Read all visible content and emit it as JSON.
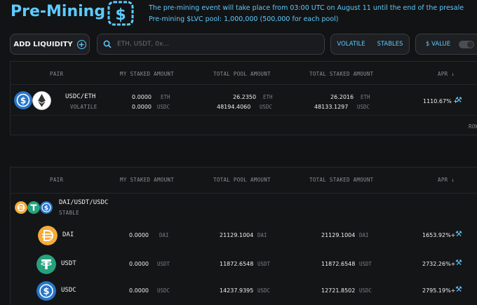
{
  "header": {
    "title": "Pre-Mining",
    "notice_line1": "The pre-mining event will take place from 03:00 UTC on August 11 until the end of the presale",
    "notice_line2": "Pre-mining $LVC pool: 1,000,000 (500,000 for each pool)"
  },
  "toolbar": {
    "add_liquidity": "ADD LIQUIDITY",
    "search_placeholder": "ETH, USDT, 0x...",
    "filter_volatile": "VOLATILE",
    "filter_stables": "STABLES",
    "value_label": "$ VALUE"
  },
  "columns": {
    "pair": "PAIR",
    "my_staked": "MY STAKED AMOUNT",
    "total_pool": "TOTAL POOL AMOUNT",
    "total_staked": "TOTAL STAKED AMOUNT",
    "apr": "APR ↓"
  },
  "volatile_pool": {
    "pair": "USDC/ETH",
    "type": "VOLATILE",
    "my_staked": [
      {
        "v": "0.0000",
        "u": "ETH"
      },
      {
        "v": "0.0000",
        "u": "USDC"
      }
    ],
    "total_pool": [
      {
        "v": "26.2350",
        "u": "ETH"
      },
      {
        "v": "48194.4060",
        "u": "USDC"
      }
    ],
    "total_staked": [
      {
        "v": "26.2016",
        "u": "ETH"
      },
      {
        "v": "48133.1297",
        "u": "USDC"
      }
    ],
    "apr": "1110.67% +",
    "rows_label": "ROW"
  },
  "stable_pool": {
    "pair": "DAI/USDT/USDC",
    "type": "STABLE",
    "tokens": [
      {
        "name": "DAI",
        "my": "0.0000",
        "pool": "21129.1004",
        "staked": "21129.1004",
        "unit": "DAI",
        "apr": "1653.92%+",
        "color": "#f5ac37"
      },
      {
        "name": "USDT",
        "my": "0.0000",
        "pool": "11872.6548",
        "staked": "11872.6548",
        "unit": "USDT",
        "apr": "2732.26%+",
        "color": "#26a17b"
      },
      {
        "name": "USDC",
        "my": "0.0000",
        "pool": "14237.9395",
        "staked": "12721.8502",
        "unit": "USDC",
        "apr": "2795.19%+",
        "color": "#2775ca"
      }
    ]
  },
  "colors": {
    "accent": "#5ecbff",
    "usdc": "#2775ca",
    "dai": "#f5ac37",
    "usdt": "#26a17b"
  }
}
